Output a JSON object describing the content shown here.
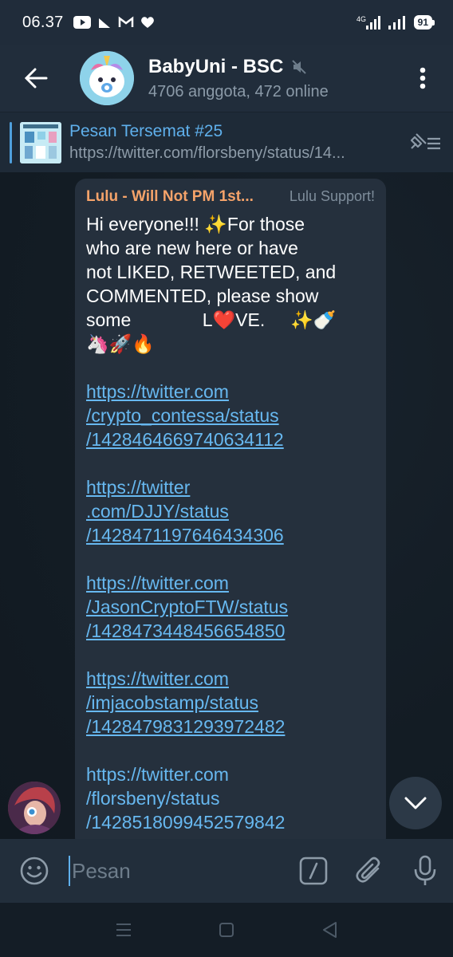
{
  "status_bar": {
    "time": "06.37",
    "network": "4G",
    "battery": "91"
  },
  "header": {
    "title": "BabyUni - BSC",
    "subtitle": "4706 anggota, 472 online"
  },
  "pinned": {
    "title": "Pesan Tersemat #25",
    "preview": "https://twitter.com/florsbeny/status/14..."
  },
  "message": {
    "sender": "Lulu - Will Not PM 1st...",
    "sender_role": "Lulu Support!",
    "text_lines": [
      "Hi everyone!!! ✨For those",
      "who are new here or have",
      "not LIKED, RETWEETED, and",
      "COMMENTED, please show",
      "some              L❤️VE.     ✨🍼",
      "🦄🚀🔥"
    ],
    "links": [
      [
        "https://twitter.com",
        "/crypto_contessa/status",
        "/1428464669740634112"
      ],
      [
        "https://twitter",
        ".com/DJJY/status",
        "/1428471197646434306"
      ],
      [
        "https://twitter.com",
        "/JasonCryptoFTW/status",
        "/1428473448456654850"
      ],
      [
        "https://twitter.com",
        "/imjacobstamp/status",
        "/1428479831293972482"
      ],
      [
        "https://twitter.com",
        "/florsbeny/status",
        "/1428518099452579842"
      ]
    ]
  },
  "input": {
    "placeholder": "Pesan"
  },
  "colors": {
    "accent": "#5fb0ec",
    "link": "#67b8f0",
    "sender_name": "#f5a36a",
    "header_bg": "#212d3b",
    "bubble_bg": "#25303d"
  },
  "icons": {
    "back": "arrow-left-icon",
    "mute": "mute-icon",
    "menu": "more-vertical-icon",
    "pinned_list": "pin-list-icon",
    "scroll_down": "chevron-down-icon",
    "emoji": "emoji-icon",
    "commands": "slash-command-icon",
    "attach": "paperclip-icon",
    "mic": "microphone-icon"
  }
}
